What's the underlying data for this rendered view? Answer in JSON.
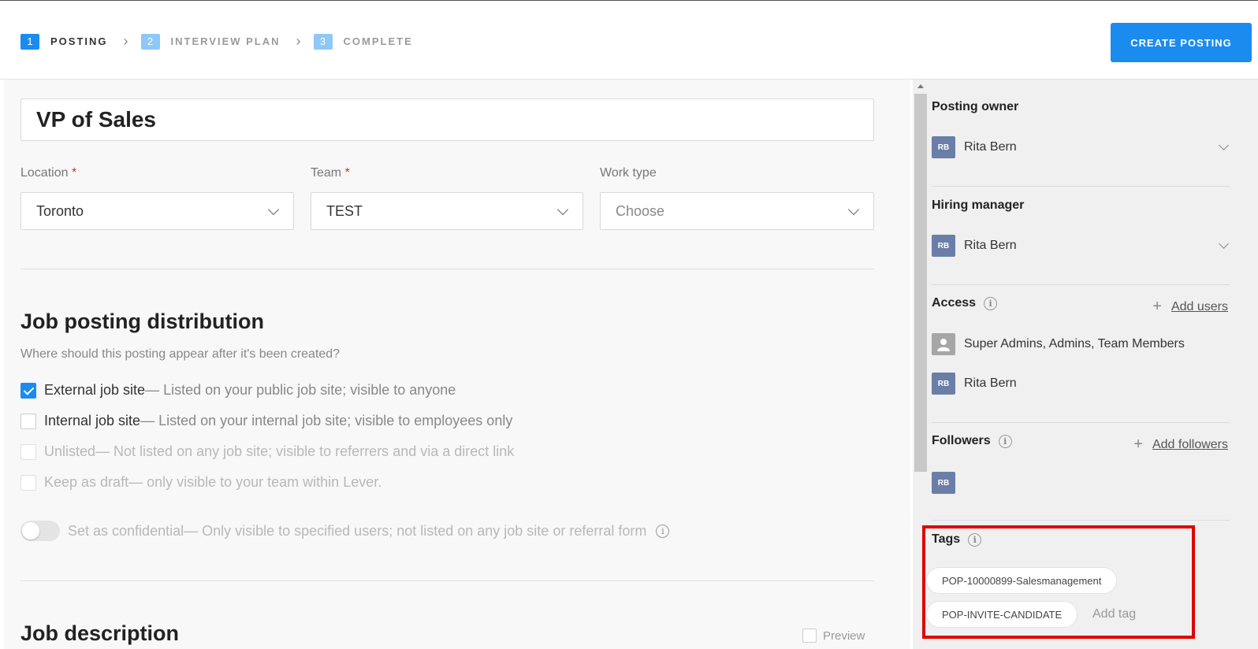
{
  "steps": [
    {
      "num": "1",
      "label": "POSTING"
    },
    {
      "num": "2",
      "label": "INTERVIEW PLAN"
    },
    {
      "num": "3",
      "label": "COMPLETE"
    }
  ],
  "create_button": "CREATE POSTING",
  "posting": {
    "title": "VP of Sales",
    "fields": {
      "location": {
        "label": "Location",
        "value": "Toronto"
      },
      "team": {
        "label": "Team",
        "value": "TEST"
      },
      "work_type": {
        "label": "Work type",
        "value": "Choose"
      }
    },
    "required_marker": "*"
  },
  "distribution": {
    "heading": "Job posting distribution",
    "subheading": "Where should this posting appear after it's been created?",
    "options": [
      {
        "name": "External job site",
        "desc": " — Listed on your public job site; visible to anyone",
        "checked": true
      },
      {
        "name": "Internal job site",
        "desc": " — Listed on your internal job site; visible to employees only",
        "checked": false
      },
      {
        "name": "Unlisted",
        "desc": " — Not listed on any job site; visible to referrers and via a direct link",
        "checked": false
      },
      {
        "name": "Keep as draft",
        "desc": " — only visible to your team within Lever.",
        "checked": false
      }
    ],
    "confidential": {
      "name": "Set as confidential",
      "desc": " — Only visible to specified users; not listed on any job site or referral form",
      "on": false
    }
  },
  "description": {
    "heading": "Job description",
    "preview_label": "Preview"
  },
  "sidebar": {
    "posting_owner": {
      "heading": "Posting owner",
      "initials": "RB",
      "name": "Rita Bern"
    },
    "hiring_manager": {
      "heading": "Hiring manager",
      "initials": "RB",
      "name": "Rita Bern"
    },
    "access": {
      "heading": "Access",
      "add_label": "Add users",
      "groups": "Super Admins, Admins, Team Members",
      "user_initials": "RB",
      "user_name": "Rita Bern"
    },
    "followers": {
      "heading": "Followers",
      "add_label": "Add followers",
      "initials": "RB"
    },
    "tags": {
      "heading": "Tags",
      "items": [
        "POP-10000899-Salesmanagement",
        "POP-INVITE-CANDIDATE"
      ],
      "add_label": "Add tag"
    }
  },
  "icons": {
    "info": "info-icon",
    "plus": "plus-icon",
    "chevron": "chevron-down-icon",
    "user": "user-icon"
  },
  "colors": {
    "accent": "#1a8cf0",
    "highlight": "#e00000",
    "avatar": "#6a7ea8"
  }
}
